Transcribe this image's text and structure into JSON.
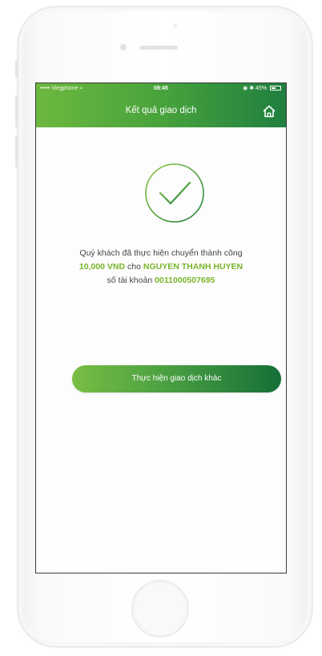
{
  "status_bar": {
    "carrier": "••••• Viegphone",
    "time": "08:45",
    "battery": "45%"
  },
  "header": {
    "title": "Kết quả giao dịch",
    "home_icon": "home-icon"
  },
  "result": {
    "icon": "check-circle-icon",
    "line1": "Quý khách đã thực hiện chuyển thành công",
    "amount": "10,000 VND",
    "to_word": "cho",
    "recipient": "NGUYEN THANH HUYEN",
    "account_label": "số tài khoản",
    "account_number": "0011000507695"
  },
  "actions": {
    "new_transaction_label": "Thực hiện giao dịch khác"
  },
  "colors": {
    "accent": "#7ab52a",
    "header_start": "#6db83f",
    "header_end": "#1f7f3f"
  }
}
